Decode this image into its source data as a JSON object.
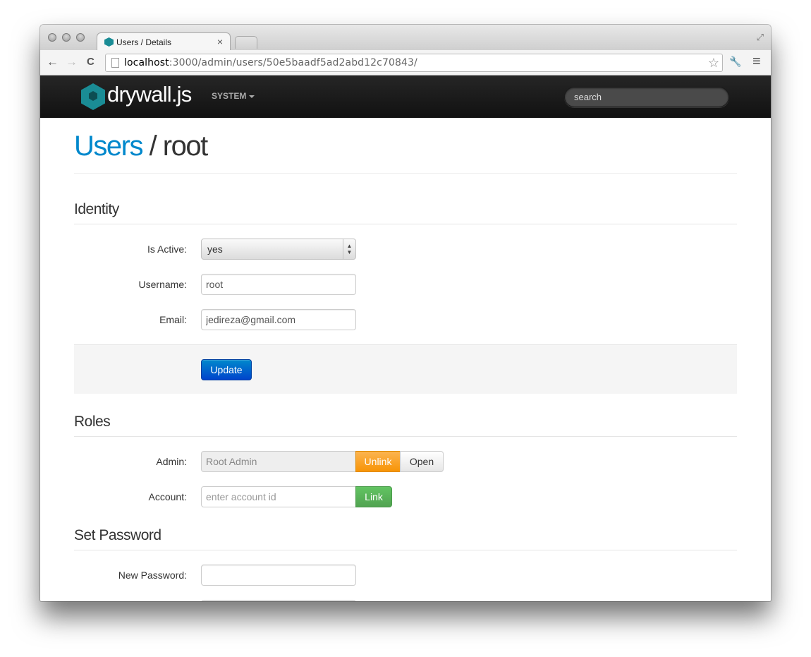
{
  "browser": {
    "tab_title": "Users / Details",
    "tab_close": "×",
    "url_host": "localhost",
    "url_path": ":3000/admin/users/50e5baadf5ad2abd12c70843/",
    "back_glyph": "←",
    "forward_glyph": "→",
    "reload_glyph": "C",
    "star_glyph": "☆",
    "wrench_glyph": "🔧",
    "menu_glyph": "≡",
    "fullscreen_glyph": "⤢"
  },
  "navbar": {
    "brand": "drywall.js",
    "system_menu": "SYSTEM",
    "search_placeholder": "search"
  },
  "page": {
    "breadcrumb_link": "Users",
    "breadcrumb_separator": " / ",
    "title": "root"
  },
  "identity": {
    "heading": "Identity",
    "is_active_label": "Is Active:",
    "is_active_value": "yes",
    "username_label": "Username:",
    "username_value": "root",
    "email_label": "Email:",
    "email_value": "jedireza@gmail.com",
    "update_button": "Update"
  },
  "roles": {
    "heading": "Roles",
    "admin_label": "Admin:",
    "admin_value": "Root Admin",
    "unlink_button": "Unlink",
    "open_button": "Open",
    "account_label": "Account:",
    "account_placeholder": "enter account id",
    "link_button": "Link"
  },
  "password": {
    "heading": "Set Password",
    "new_password_label": "New Password:",
    "new_password_value": ""
  },
  "colors": {
    "accent": "#0088cc",
    "warning": "#f89406",
    "success": "#51a351",
    "primary": "#0044cc"
  }
}
